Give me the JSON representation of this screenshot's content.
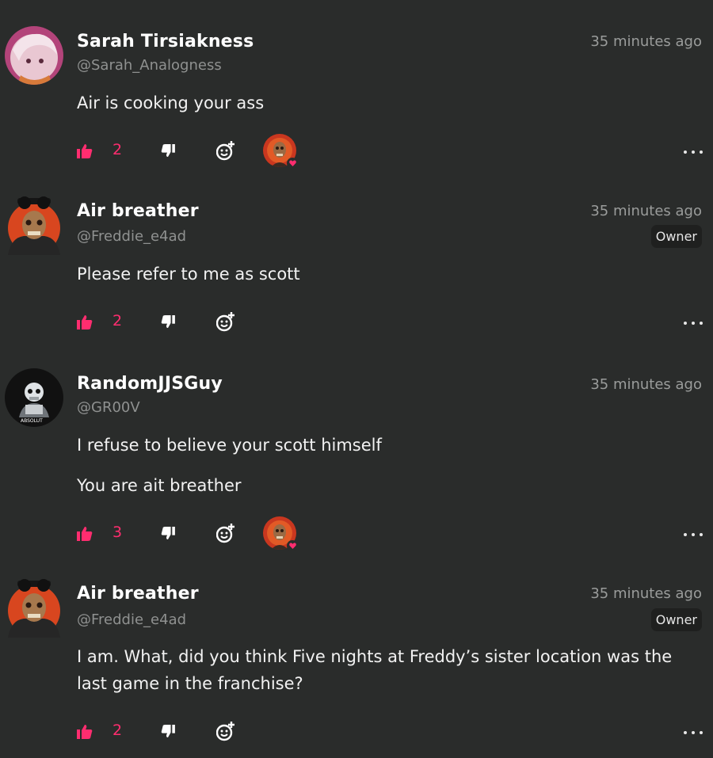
{
  "accent_color": "#ff2d6f",
  "comments": [
    {
      "author": "Sarah Tirsiakness",
      "handle": "@Sarah_Analogness",
      "time": "35 minutes ago",
      "badge": "",
      "text": [
        "Air is cooking your ass"
      ],
      "likes": "2",
      "has_reaction": true
    },
    {
      "author": "Air breather",
      "handle": "@Freddie_e4ad",
      "time": "35 minutes ago",
      "badge": "Owner",
      "text": [
        "Please refer to me as scott"
      ],
      "likes": "2",
      "has_reaction": false
    },
    {
      "author": "RandomJJSGuy",
      "handle": "@GR00V",
      "time": "35 minutes ago",
      "badge": "",
      "text": [
        "I refuse to believe your scott himself",
        "You are ait breather"
      ],
      "likes": "3",
      "has_reaction": true
    },
    {
      "author": "Air breather",
      "handle": "@Freddie_e4ad",
      "time": "35 minutes ago",
      "badge": "Owner",
      "text": [
        "I am. What, did you think Five nights at Freddy’s sister location was the last game in the franchise?"
      ],
      "likes": "2",
      "has_reaction": false
    }
  ],
  "icons": {
    "like": "thumbs-up-icon",
    "dislike": "thumbs-down-icon",
    "react": "add-reaction-icon",
    "more": "more-options-icon"
  }
}
